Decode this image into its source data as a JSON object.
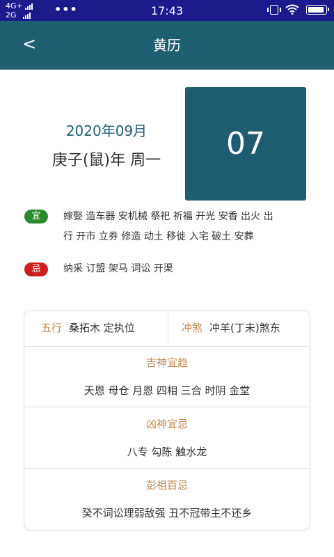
{
  "status_bar": {
    "network_top": "4G+",
    "network_bottom": "2G",
    "more": "•••",
    "time": "17:43"
  },
  "app_bar": {
    "back": "<",
    "title": "黄历"
  },
  "date": {
    "year_month": "2020年09月",
    "year_weekday": "庚子(鼠)年   周一",
    "day": "07"
  },
  "yi": {
    "badge": "宜",
    "line1": "嫁娶 造车器 安机械 祭祀 祈福 开光 安香 出火 出",
    "line2": "行 开市 立券 修造 动土 移徙 入宅 破土 安葬"
  },
  "ji": {
    "badge": "忌",
    "text": "纳采 订盟 架马 词讼 开渠"
  },
  "details": {
    "wuxing_label": "五行",
    "wuxing_value": "桑拓木 定执位",
    "chongsha_label": "冲煞",
    "chongsha_value": "冲羊(丁未)煞东",
    "jishen_label": "吉神宜趋",
    "jishen_value": "天恩 母仓 月恩 四相 三合 时阴 金堂",
    "xiongshen_label": "凶神宜忌",
    "xiongshen_value": "八专 勾陈 触水龙",
    "pengzu_label": "彭祖百忌",
    "pengzu_value": "癸不词讼理弱敌强 丑不冠带主不还乡"
  },
  "colors": {
    "status_bar": "#1d1a8c",
    "app_bar": "#1f5f72",
    "day_box": "#1d5c71",
    "yi_badge": "#2a8a2f",
    "ji_badge": "#cc1f1f",
    "label": "#c08a4f"
  }
}
